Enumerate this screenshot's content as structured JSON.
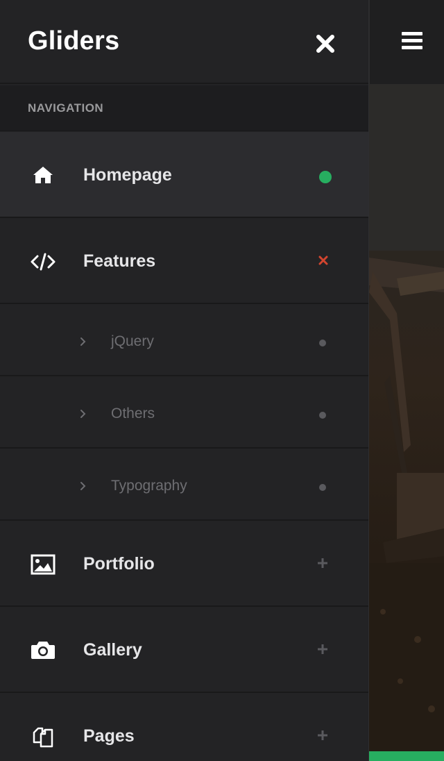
{
  "sidebar": {
    "brand": "Gliders",
    "section_label": "NAVIGATION",
    "items": [
      {
        "label": "Homepage",
        "icon": "home-icon",
        "indicator": "green-dot"
      },
      {
        "label": "Features",
        "icon": "code-icon",
        "indicator": "close-x-red"
      },
      {
        "label": "jQuery",
        "icon": "chevron-right-icon",
        "indicator": "grey-dot"
      },
      {
        "label": "Others",
        "icon": "chevron-right-icon",
        "indicator": "grey-dot"
      },
      {
        "label": "Typography",
        "icon": "chevron-right-icon",
        "indicator": "grey-dot"
      },
      {
        "label": "Portfolio",
        "icon": "image-icon",
        "indicator": "plus"
      },
      {
        "label": "Gallery",
        "icon": "camera-icon",
        "indicator": "plus"
      },
      {
        "label": "Pages",
        "icon": "copy-pages-icon",
        "indicator": "plus"
      }
    ]
  },
  "colors": {
    "accent_green": "#27ae60",
    "close_red": "#d2452f",
    "sidebar_bg": "#232325"
  }
}
